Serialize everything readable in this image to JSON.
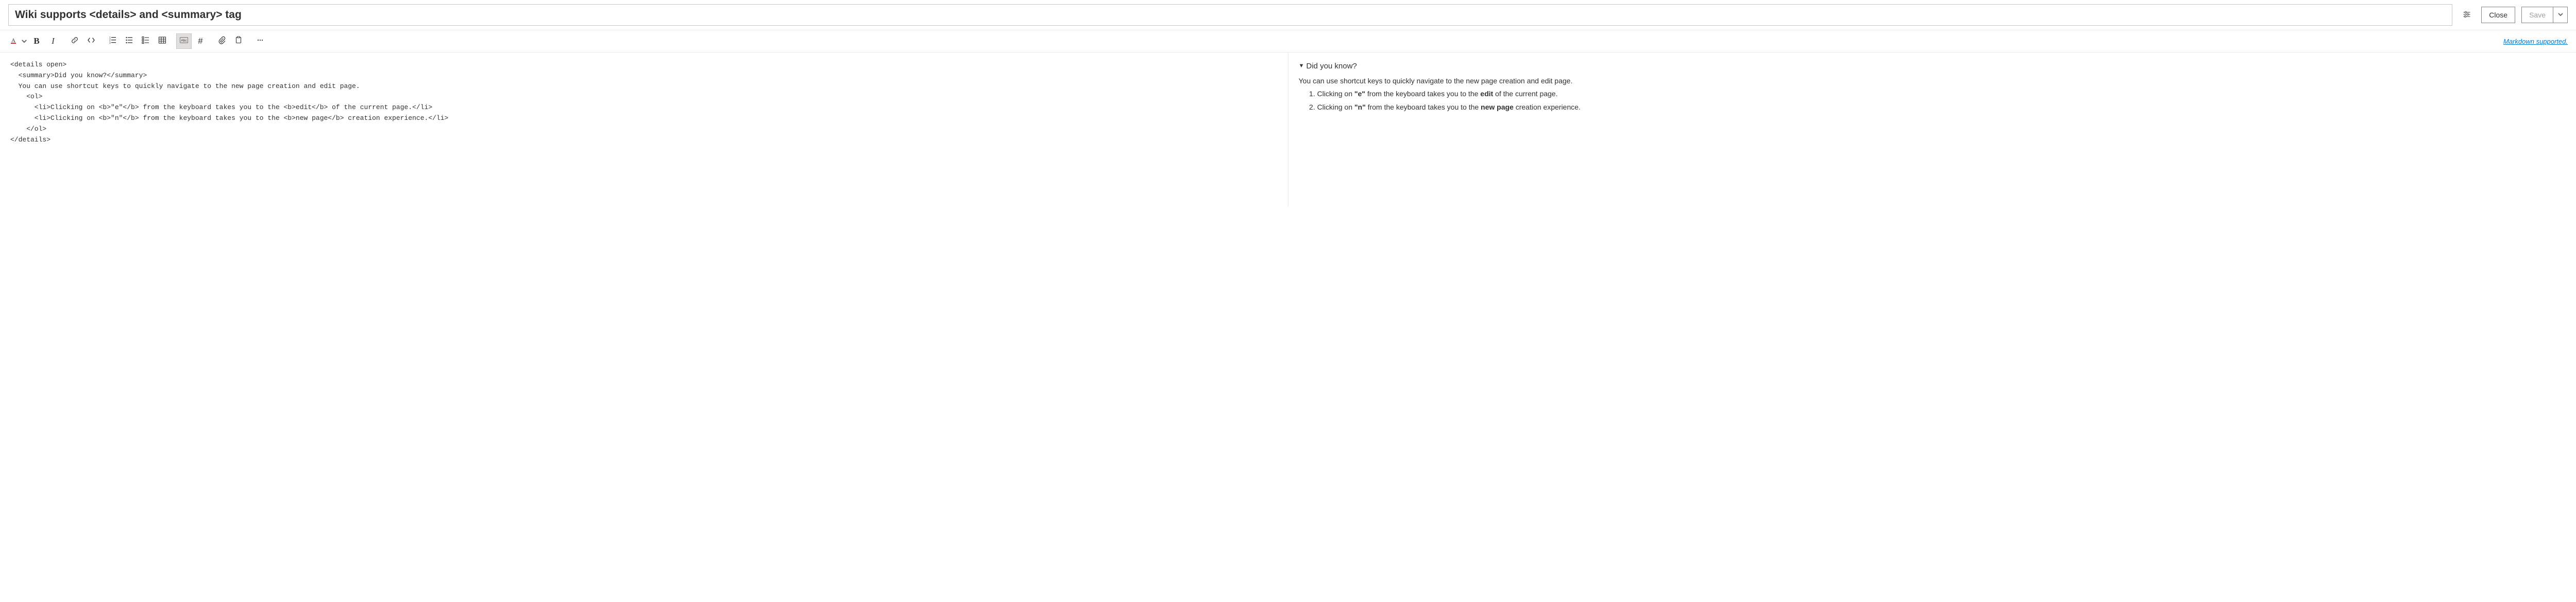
{
  "title": {
    "value": "Wiki supports <details> and <summary> tag"
  },
  "header_buttons": {
    "close": "Close",
    "save": "Save"
  },
  "toolbar_right": {
    "markdown_link": "Markdown supported."
  },
  "editor": {
    "source": "<details open>\n  <summary>Did you know?</summary>\n  You can use shortcut keys to quickly navigate to the new page creation and edit page.\n    <ol>\n      <li>Clicking on <b>\"e\"</b> from the keyboard takes you to the <b>edit</b> of the current page.</li>\n      <li>Clicking on <b>\"n\"</b> from the keyboard takes you to the <b>new page</b> creation experience.</li>\n    </ol>\n</details>"
  },
  "preview": {
    "summary": "Did you know?",
    "intro": "You can use shortcut keys to quickly navigate to the new page creation and edit page.",
    "items": [
      {
        "pre": "Clicking on ",
        "b1": "\"e\"",
        "mid": " from the keyboard takes you to the ",
        "b2": "edit",
        "post": " of the current page."
      },
      {
        "pre": "Clicking on ",
        "b1": "\"n\"",
        "mid": " from the keyboard takes you to the ",
        "b2": "new page",
        "post": " creation experience."
      }
    ]
  }
}
